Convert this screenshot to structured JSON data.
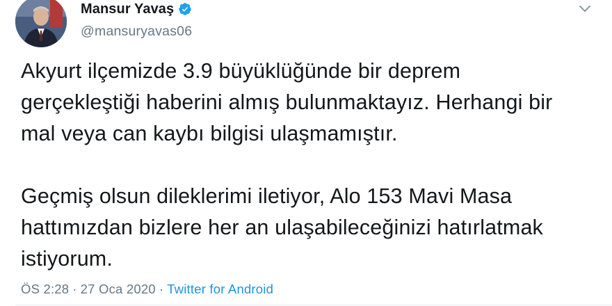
{
  "author": {
    "display_name": "Mansur Yavaş",
    "handle": "@mansuryavas06",
    "verified": true,
    "verified_color": "#1da1f2"
  },
  "tweet": {
    "paragraphs": [
      "Akyurt ilçemizde 3.9 büyüklüğünde bir deprem\ngerçekleştiği haberini almış bulunmaktayız. Herhangi bir\nmal veya can kaybı bilgisi ulaşmamıştır.",
      "Geçmiş olsun dileklerimi iletiyor, Alo 153 Mavi Masa\nhattımızdan bizlere her an ulaşabileceğinizi hatırlatmak\nistiyorum."
    ]
  },
  "meta": {
    "time": "ÖS 2:28",
    "date": "27 Oca 2020",
    "separator": "·",
    "source": "Twitter for Android",
    "link_color": "#1b95e0"
  },
  "icons": {
    "verified": "verified-badge-icon",
    "menu": "chevron-down-icon"
  }
}
